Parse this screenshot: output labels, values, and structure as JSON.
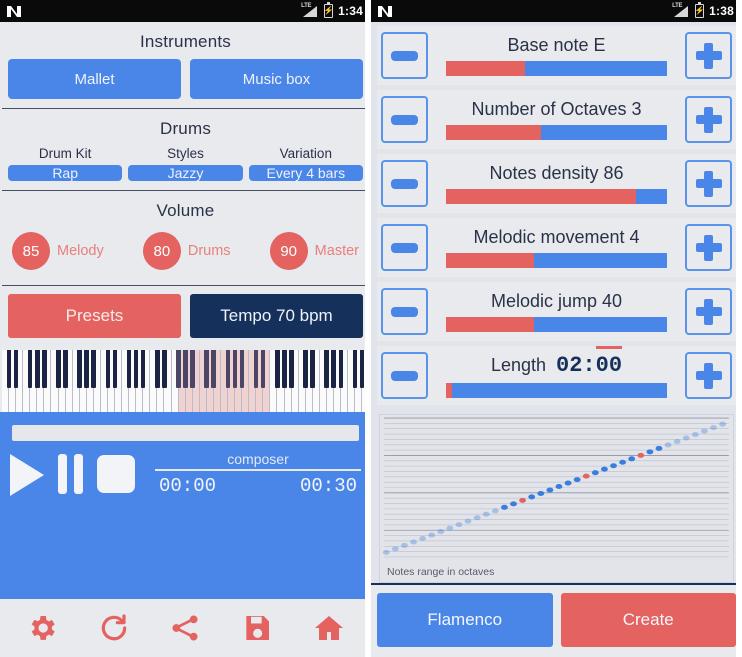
{
  "left": {
    "status_bar": {
      "time": "1:34",
      "network": "LTE",
      "icons": [
        "nova-launcher-icon",
        "signal-icon",
        "battery-icon"
      ]
    },
    "instruments": {
      "title": "Instruments",
      "buttons": [
        {
          "label": "Mallet",
          "name": "instrument-mallet-button"
        },
        {
          "label": "Music box",
          "name": "instrument-music-box-button"
        }
      ]
    },
    "drums": {
      "title": "Drums",
      "columns": [
        {
          "label": "Drum Kit",
          "value": "Rap"
        },
        {
          "label": "Styles",
          "value": "Jazzy"
        },
        {
          "label": "Variation",
          "value": "Every 4 bars"
        }
      ]
    },
    "volume": {
      "title": "Volume",
      "items": [
        {
          "value": "85",
          "label": "Melody"
        },
        {
          "value": "80",
          "label": "Drums"
        },
        {
          "value": "90",
          "label": "Master"
        }
      ]
    },
    "presets_row": {
      "presets_label": "Presets",
      "tempo_label": "Tempo 70 bpm"
    },
    "transport": {
      "title": "composer",
      "elapsed": "00:00",
      "total": "00:30",
      "play": "play-button",
      "pause": "pause-button",
      "stop": "stop-button"
    },
    "toolbar": [
      {
        "name": "settings-gear-icon"
      },
      {
        "name": "refresh-icon"
      },
      {
        "name": "share-icon"
      },
      {
        "name": "save-icon"
      },
      {
        "name": "home-icon"
      }
    ]
  },
  "right": {
    "status_bar": {
      "time": "1:38",
      "network": "LTE"
    },
    "params": [
      {
        "label": "Base note E",
        "fill": 36
      },
      {
        "label": "Number of Octaves 3",
        "fill": 43
      },
      {
        "label": "Notes density 86",
        "fill": 86
      },
      {
        "label": "Melodic movement 4",
        "fill": 40
      },
      {
        "label": "Melodic jump 40",
        "fill": 40
      },
      {
        "label": "Length",
        "value": "02:00",
        "fill": 3
      }
    ],
    "chart_caption": "Notes range in octaves",
    "actions": [
      {
        "label": "Flamenco",
        "name": "flamenco-style-button"
      },
      {
        "label": "Create",
        "name": "create-button"
      }
    ]
  },
  "colors": {
    "blue": "#4a86e8",
    "red": "#e4625f",
    "navy": "#16305c",
    "panel": "#e8eaee"
  },
  "chart_data": {
    "type": "scatter",
    "title": "",
    "xlabel": "Notes range in octaves",
    "ylabel": "",
    "grid": true,
    "gridlines": 26,
    "octave_lines": [
      0,
      7,
      14,
      21
    ],
    "x": [
      0,
      1,
      2,
      3,
      4,
      5,
      6,
      7,
      8,
      9,
      10,
      11,
      12,
      13,
      14,
      15,
      16,
      17,
      18,
      19,
      20,
      21,
      22,
      23,
      24,
      25,
      26,
      27,
      28,
      29,
      30,
      31,
      32,
      33,
      34,
      35,
      36,
      37
    ],
    "y": [
      0,
      1,
      2,
      3,
      4,
      5,
      6,
      7,
      8,
      9,
      10,
      11,
      12,
      13,
      14,
      15,
      16,
      17,
      18,
      19,
      20,
      21,
      22,
      23,
      24,
      25,
      26,
      27,
      28,
      29,
      30,
      31,
      32,
      33,
      34,
      35,
      36,
      37
    ],
    "point_colors": [
      "faded-blue",
      "faded-blue",
      "faded-blue",
      "faded-blue",
      "faded-blue",
      "faded-blue",
      "faded-blue",
      "faded-blue",
      "faded-blue",
      "faded-blue",
      "faded-blue",
      "faded-blue",
      "faded-blue",
      "blue",
      "blue",
      "red",
      "blue",
      "blue",
      "blue",
      "blue",
      "blue",
      "blue",
      "red",
      "blue",
      "blue",
      "blue",
      "blue",
      "blue",
      "red",
      "blue",
      "blue",
      "faded-blue",
      "faded-blue",
      "faded-blue",
      "faded-blue",
      "faded-blue",
      "faded-blue",
      "faded-blue"
    ],
    "highlight_color": "#e4625f",
    "series_color": "#3b7ddd"
  }
}
